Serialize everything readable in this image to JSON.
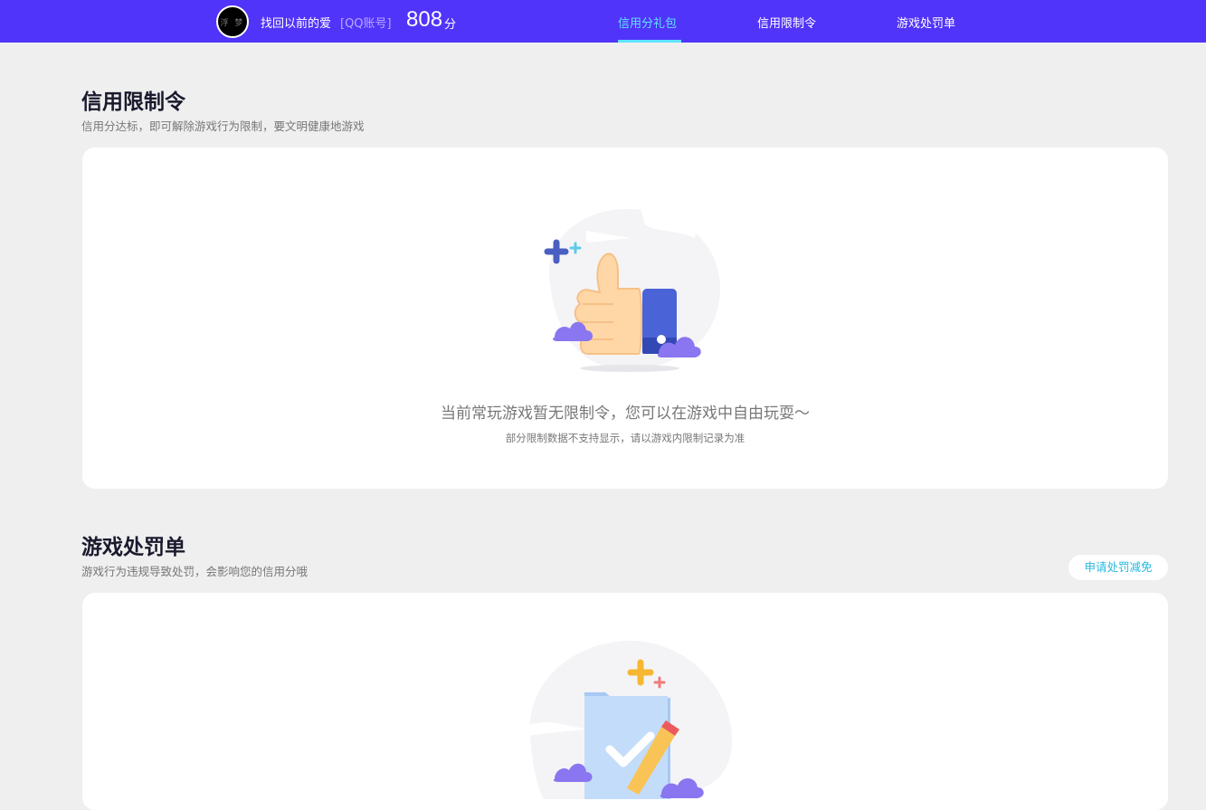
{
  "header": {
    "avatar_text": "浮 梦",
    "username": "找回以前的爱",
    "account_type": "[QQ账号]",
    "score": "808",
    "score_unit": "分",
    "tabs": [
      {
        "label": "信用分礼包",
        "active": true
      },
      {
        "label": "信用限制令",
        "active": false
      },
      {
        "label": "游戏处罚单",
        "active": false
      }
    ]
  },
  "restriction": {
    "title": "信用限制令",
    "subtitle": "信用分达标，即可解除游戏行为限制，要文明健康地游戏",
    "empty_message": "当前常玩游戏暂无限制令，您可以在游戏中自由玩耍～",
    "empty_note": "部分限制数据不支持显示，请以游戏内限制记录为准",
    "illustration_icon": "thumbs-up-icon"
  },
  "penalty": {
    "title": "游戏处罚单",
    "subtitle": "游戏行为违规导致处罚，会影响您的信用分哦",
    "apply_button": "申请处罚减免",
    "illustration_icon": "checklist-pencil-icon"
  },
  "colors": {
    "nav_bg": "#5134f9",
    "active_tab": "#5fe4ff",
    "page_bg": "#efefef",
    "accent_link": "#27b8e0"
  }
}
